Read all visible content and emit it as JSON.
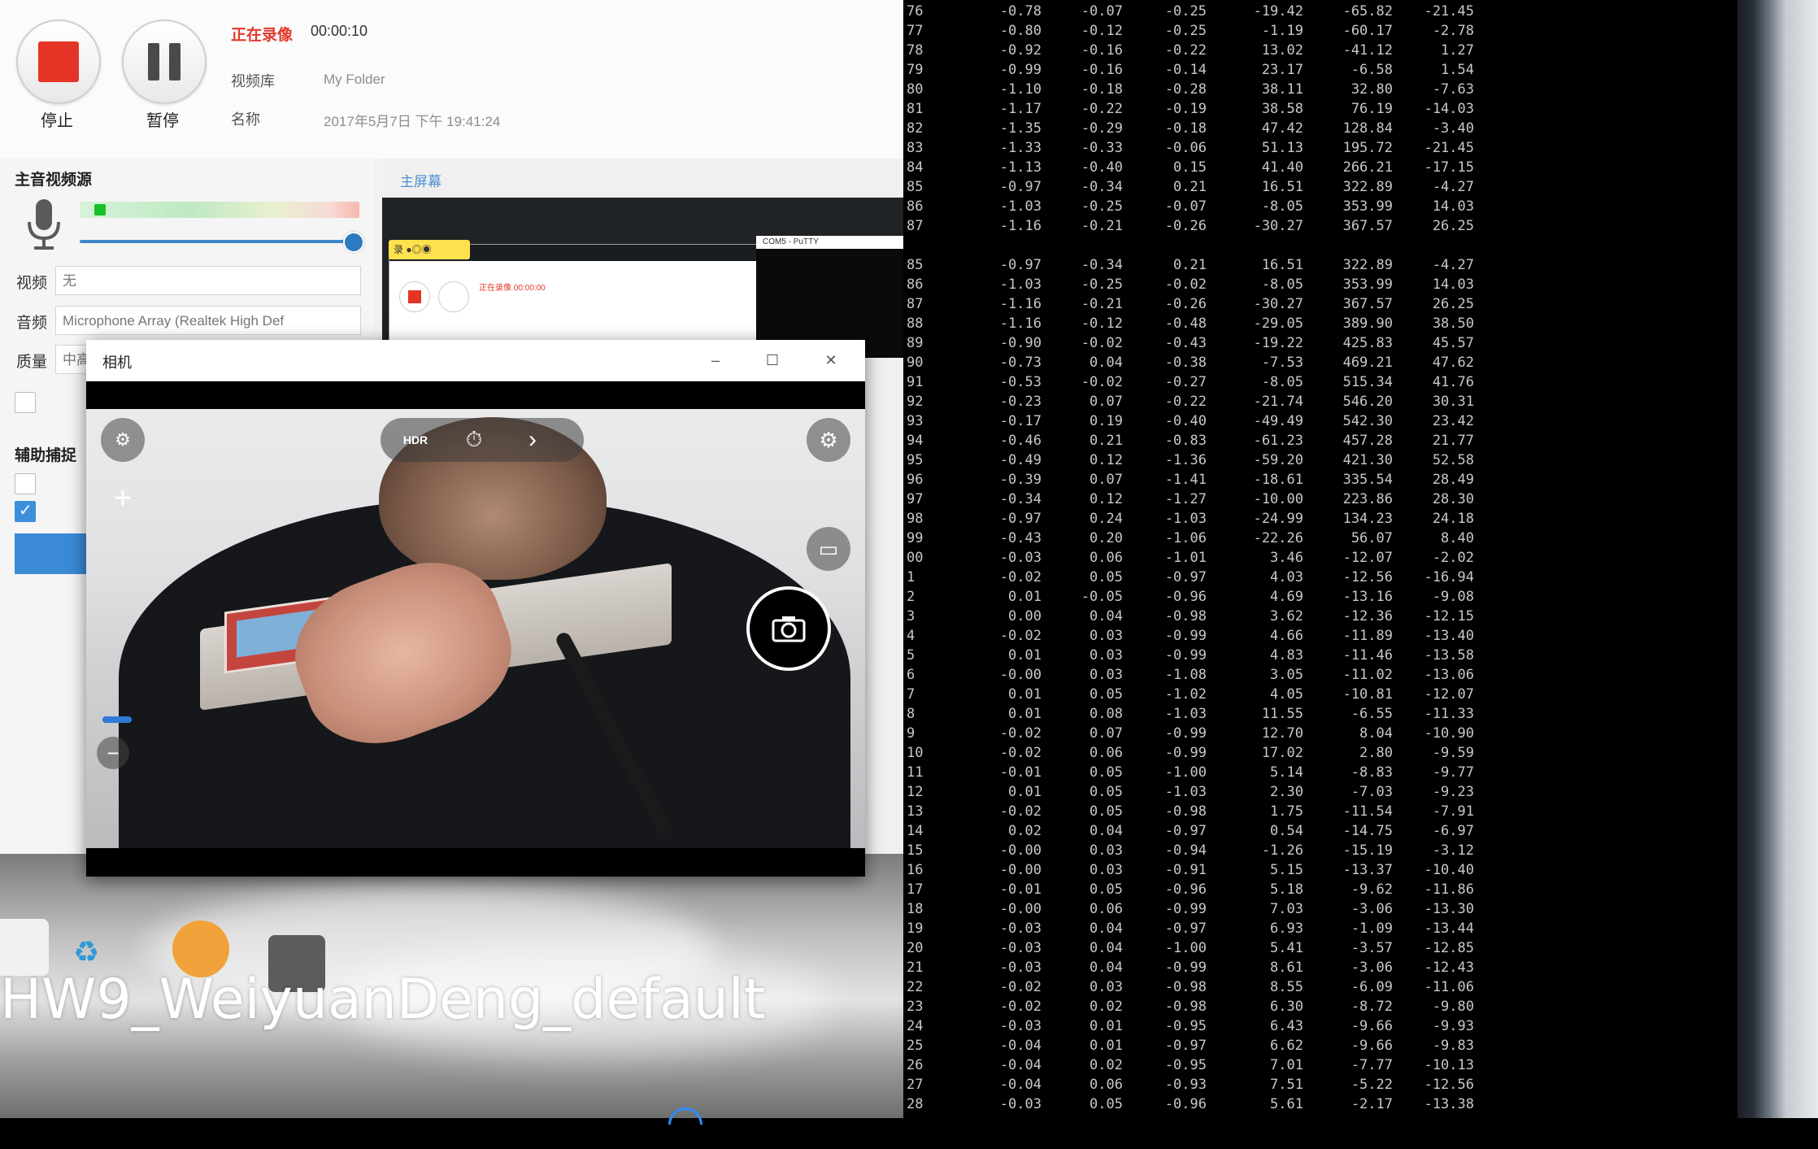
{
  "recorder": {
    "stop_label": "停止",
    "pause_label": "暂停",
    "status": "正在录像",
    "elapsed": "00:00:10",
    "library_label": "视频库",
    "library_value": "My Folder",
    "name_label": "名称",
    "name_value": "2017年5月7日 下午 19:41:24",
    "audio_video_source_title": "主音视频源",
    "video_label": "视频",
    "video_value": "无",
    "audio_label": "音频",
    "audio_value": "Microphone Array (Realtek High Def",
    "quality_label": "质量",
    "quality_value": "中高",
    "aux_capture_title": "辅助捕捉",
    "tab_main_screen": "主屏幕",
    "mini_yellow_label": "录 ●◎◉",
    "mini_status": "正在录像 00:00:00",
    "mini_terminal_title": "COM5 - PuTTY"
  },
  "camera": {
    "title": "相机",
    "minimize": "–",
    "maximize": "☐",
    "close": "✕",
    "icons": {
      "top_left": "camera-switch-icon",
      "plus": "plus-icon",
      "hdr": "hdr-off-icon",
      "timer": "timer-off-icon",
      "more": "chevron-right-icon",
      "settings": "gear-icon",
      "video_mode": "video-camera-icon",
      "shutter": "camera-icon",
      "zoom_minus": "minus-icon"
    },
    "glyphs": {
      "top_left": "⚙",
      "plus": "+",
      "hdr": "HDR",
      "timer": "⏱",
      "more": "›",
      "settings": "⚙",
      "video_mode": "▭",
      "zoom_minus": "−"
    }
  },
  "desktop": {
    "video_title": "HW9_WeiyuanDeng_default"
  },
  "terminal": {
    "rows": [
      [
        "76",
        "-0.78",
        "-0.07",
        "-0.25",
        "-19.42",
        "-65.82",
        "-21.45"
      ],
      [
        "77",
        "-0.80",
        "-0.12",
        "-0.25",
        "-1.19",
        "-60.17",
        "-2.78"
      ],
      [
        "78",
        "-0.92",
        "-0.16",
        "-0.22",
        "13.02",
        "-41.12",
        "1.27"
      ],
      [
        "79",
        "-0.99",
        "-0.16",
        "-0.14",
        "23.17",
        "-6.58",
        "1.54"
      ],
      [
        "80",
        "-1.10",
        "-0.18",
        "-0.28",
        "38.11",
        "32.80",
        "-7.63"
      ],
      [
        "81",
        "-1.17",
        "-0.22",
        "-0.19",
        "38.58",
        "76.19",
        "-14.03"
      ],
      [
        "82",
        "-1.35",
        "-0.29",
        "-0.18",
        "47.42",
        "128.84",
        "-3.40"
      ],
      [
        "83",
        "-1.33",
        "-0.33",
        "-0.06",
        "51.13",
        "195.72",
        "-21.45"
      ],
      [
        "84",
        "-1.13",
        "-0.40",
        "0.15",
        "41.40",
        "266.21",
        "-17.15"
      ],
      [
        "85",
        "-0.97",
        "-0.34",
        "0.21",
        "16.51",
        "322.89",
        "-4.27"
      ],
      [
        "86",
        "-1.03",
        "-0.25",
        "-0.07",
        "-8.05",
        "353.99",
        "14.03"
      ],
      [
        "87",
        "-1.16",
        "-0.21",
        "-0.26",
        "-30.27",
        "367.57",
        "26.25"
      ],
      [
        "",
        "",
        "",
        "",
        "",
        "",
        ""
      ],
      [
        "85",
        "-0.97",
        "-0.34",
        "0.21",
        "16.51",
        "322.89",
        "-4.27"
      ],
      [
        "86",
        "-1.03",
        "-0.25",
        "-0.02",
        "-8.05",
        "353.99",
        "14.03"
      ],
      [
        "87",
        "-1.16",
        "-0.21",
        "-0.26",
        "-30.27",
        "367.57",
        "26.25"
      ],
      [
        "88",
        "-1.16",
        "-0.12",
        "-0.48",
        "-29.05",
        "389.90",
        "38.50"
      ],
      [
        "89",
        "-0.90",
        "-0.02",
        "-0.43",
        "-19.22",
        "425.83",
        "45.57"
      ],
      [
        "90",
        "-0.73",
        "0.04",
        "-0.38",
        "-7.53",
        "469.21",
        "47.62"
      ],
      [
        "91",
        "-0.53",
        "-0.02",
        "-0.27",
        "-8.05",
        "515.34",
        "41.76"
      ],
      [
        "92",
        "-0.23",
        "0.07",
        "-0.22",
        "-21.74",
        "546.20",
        "30.31"
      ],
      [
        "93",
        "-0.17",
        "0.19",
        "-0.40",
        "-49.49",
        "542.30",
        "23.42"
      ],
      [
        "94",
        "-0.46",
        "0.21",
        "-0.83",
        "-61.23",
        "457.28",
        "21.77"
      ],
      [
        "95",
        "-0.49",
        "0.12",
        "-1.36",
        "-59.20",
        "421.30",
        "52.58"
      ],
      [
        "96",
        "-0.39",
        "0.07",
        "-1.41",
        "-18.61",
        "335.54",
        "28.49"
      ],
      [
        "97",
        "-0.34",
        "0.12",
        "-1.27",
        "-10.00",
        "223.86",
        "28.30"
      ],
      [
        "98",
        "-0.97",
        "0.24",
        "-1.03",
        "-24.99",
        "134.23",
        "24.18"
      ],
      [
        "99",
        "-0.43",
        "0.20",
        "-1.06",
        "-22.26",
        "56.07",
        "8.40"
      ],
      [
        "00",
        "-0.03",
        "0.06",
        "-1.01",
        "3.46",
        "-12.07",
        "-2.02"
      ],
      [
        "1",
        "-0.02",
        "0.05",
        "-0.97",
        "4.03",
        "-12.56",
        "-16.94"
      ],
      [
        "2",
        "0.01",
        "-0.05",
        "-0.96",
        "4.69",
        "-13.16",
        "-9.08"
      ],
      [
        "3",
        "0.00",
        "0.04",
        "-0.98",
        "3.62",
        "-12.36",
        "-12.15"
      ],
      [
        "4",
        "-0.02",
        "0.03",
        "-0.99",
        "4.66",
        "-11.89",
        "-13.40"
      ],
      [
        "5",
        "0.01",
        "0.03",
        "-0.99",
        "4.83",
        "-11.46",
        "-13.58"
      ],
      [
        "6",
        "-0.00",
        "0.03",
        "-1.08",
        "3.05",
        "-11.02",
        "-13.06"
      ],
      [
        "7",
        "0.01",
        "0.05",
        "-1.02",
        "4.05",
        "-10.81",
        "-12.07"
      ],
      [
        "8",
        "0.01",
        "0.08",
        "-1.03",
        "11.55",
        "-6.55",
        "-11.33"
      ],
      [
        "9",
        "-0.02",
        "0.07",
        "-0.99",
        "12.70",
        "8.04",
        "-10.90"
      ],
      [
        "10",
        "-0.02",
        "0.06",
        "-0.99",
        "17.02",
        "2.80",
        "-9.59"
      ],
      [
        "11",
        "-0.01",
        "0.05",
        "-1.00",
        "5.14",
        "-8.83",
        "-9.77"
      ],
      [
        "12",
        "0.01",
        "0.05",
        "-1.03",
        "2.30",
        "-7.03",
        "-9.23"
      ],
      [
        "13",
        "-0.02",
        "0.05",
        "-0.98",
        "1.75",
        "-11.54",
        "-7.91"
      ],
      [
        "14",
        "0.02",
        "0.04",
        "-0.97",
        "0.54",
        "-14.75",
        "-6.97"
      ],
      [
        "15",
        "-0.00",
        "0.03",
        "-0.94",
        "-1.26",
        "-15.19",
        "-3.12"
      ],
      [
        "16",
        "-0.00",
        "0.03",
        "-0.91",
        "5.15",
        "-13.37",
        "-10.40"
      ],
      [
        "17",
        "-0.01",
        "0.05",
        "-0.96",
        "5.18",
        "-9.62",
        "-11.86"
      ],
      [
        "18",
        "-0.00",
        "0.06",
        "-0.99",
        "7.03",
        "-3.06",
        "-13.30"
      ],
      [
        "19",
        "-0.03",
        "0.04",
        "-0.97",
        "6.93",
        "-1.09",
        "-13.44"
      ],
      [
        "20",
        "-0.03",
        "0.04",
        "-1.00",
        "5.41",
        "-3.57",
        "-12.85"
      ],
      [
        "21",
        "-0.03",
        "0.04",
        "-0.99",
        "8.61",
        "-3.06",
        "-12.43"
      ],
      [
        "22",
        "-0.02",
        "0.03",
        "-0.98",
        "8.55",
        "-6.09",
        "-11.06"
      ],
      [
        "23",
        "-0.02",
        "0.02",
        "-0.98",
        "6.30",
        "-8.72",
        "-9.80"
      ],
      [
        "24",
        "-0.03",
        "0.01",
        "-0.95",
        "6.43",
        "-9.66",
        "-9.93"
      ],
      [
        "25",
        "-0.04",
        "0.01",
        "-0.97",
        "6.62",
        "-9.66",
        "-9.83"
      ],
      [
        "26",
        "-0.04",
        "0.02",
        "-0.95",
        "7.01",
        "-7.77",
        "-10.13"
      ],
      [
        "27",
        "-0.04",
        "0.06",
        "-0.93",
        "7.51",
        "-5.22",
        "-12.56"
      ],
      [
        "28",
        "-0.03",
        "0.05",
        "-0.96",
        "5.61",
        "-2.17",
        "-13.38"
      ]
    ]
  },
  "colors": {
    "record_red": "#e53426",
    "accent_blue": "#3a8ad6",
    "meter_green": "#17c127"
  }
}
